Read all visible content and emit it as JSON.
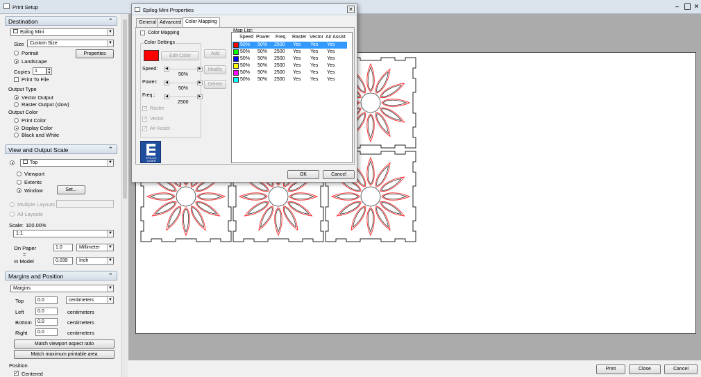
{
  "window": {
    "title": "Print Setup"
  },
  "destination": {
    "header": "Destination",
    "printer": "Epilog Mini",
    "size_label": "Size",
    "size_value": "Custom Size",
    "properties": "Properties",
    "portrait": "Portrait",
    "landscape": "Landscape",
    "copies_label": "Copies",
    "copies": "1",
    "print_to_file": "Print To File",
    "output_type": "Output Type",
    "vector_output": "Vector Output",
    "raster_output": "Raster Output (slow)",
    "output_color": "Output Color",
    "print_color": "Print Color",
    "display_color": "Display Color",
    "black_white": "Black and White"
  },
  "view": {
    "header": "View and Output Scale",
    "viewport_value": "Top",
    "viewport": "Viewport",
    "extents": "Extents",
    "window": "Window",
    "set": "Set...",
    "multiple_layouts": "Multiple Layouts",
    "all_layouts": "All Layouts",
    "scale_label": "Scale:",
    "scale_pct": "100.00%",
    "scale_value": "1:1",
    "on_paper": "On Paper",
    "on_paper_value": "1.0",
    "on_paper_unit": "Millimeter",
    "equals": "=",
    "in_model": "In Model",
    "in_model_value": "0.039",
    "in_model_unit": "Inch"
  },
  "margins": {
    "header": "Margins and Position",
    "mode": "Margins",
    "top_label": "Top",
    "top": "0.0",
    "top_unit": "centimeters",
    "left_label": "Left",
    "left": "0.0",
    "left_unit": "centimeters",
    "bottom_label": "Bottom",
    "bottom": "0.0",
    "bottom_unit": "centimeters",
    "right_label": "Right",
    "right": "0.0",
    "right_unit": "centimeters",
    "match_aspect": "Match viewport aspect ratio",
    "match_max": "Match maximum printable area",
    "position_label": "Position",
    "centered": "Centered"
  },
  "footer": {
    "print": "Print",
    "close": "Close",
    "cancel": "Cancel"
  },
  "dialog": {
    "title": "Epilog Mini Properties",
    "tabs": [
      "General",
      "Advanced",
      "Color Mapping"
    ],
    "color_mapping": "Color Mapping",
    "color_settings": "Color Settings",
    "edit_color": "Edit Color",
    "speed_label": "Speed:",
    "speed": "50%",
    "power_label": "Power:",
    "power": "50%",
    "freq_label": "Freq.:",
    "freq": "2500",
    "raster": "Raster",
    "vector": "Vector",
    "air_assist": "Air Assist",
    "add": "Add",
    "modify": "Modify",
    "delete": "Delete",
    "map_list": "Map List:",
    "ok": "OK",
    "cancel": "Cancel",
    "logo_text": "EPILOG LASER",
    "swatch_color": "#ff0000"
  },
  "map_list": {
    "columns": [
      "Speed",
      "Power",
      "Freq.",
      "Raster",
      "Vector",
      "Air Assist"
    ],
    "rows": [
      {
        "color": "#ff0000",
        "speed": "50%",
        "power": "50%",
        "freq": "2500",
        "raster": "Yes",
        "vector": "Yes",
        "air": "Yes"
      },
      {
        "color": "#00ff00",
        "speed": "50%",
        "power": "50%",
        "freq": "2500",
        "raster": "Yes",
        "vector": "Yes",
        "air": "Yes"
      },
      {
        "color": "#0000ff",
        "speed": "50%",
        "power": "50%",
        "freq": "2500",
        "raster": "Yes",
        "vector": "Yes",
        "air": "Yes"
      },
      {
        "color": "#ffff00",
        "speed": "50%",
        "power": "50%",
        "freq": "2500",
        "raster": "Yes",
        "vector": "Yes",
        "air": "Yes"
      },
      {
        "color": "#ff00ff",
        "speed": "50%",
        "power": "50%",
        "freq": "2500",
        "raster": "Yes",
        "vector": "Yes",
        "air": "Yes"
      },
      {
        "color": "#00ffff",
        "speed": "50%",
        "power": "50%",
        "freq": "2500",
        "raster": "Yes",
        "vector": "Yes",
        "air": "Yes"
      }
    ]
  }
}
